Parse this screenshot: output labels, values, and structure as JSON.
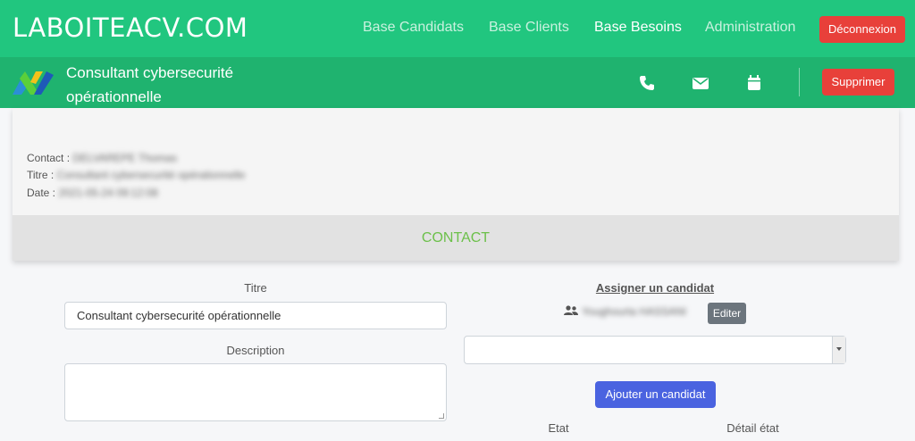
{
  "app": {
    "brand": "LABOITEACV.COM"
  },
  "nav": {
    "items": [
      {
        "label": "Base Candidats",
        "active": false
      },
      {
        "label": "Base Clients",
        "active": false
      },
      {
        "label": "Base Besoins",
        "active": true
      },
      {
        "label": "Administration",
        "active": false
      }
    ],
    "logout_label": "Déconnexion"
  },
  "subheader": {
    "title": "Consultant cybersecurité opérationnelle",
    "icons": [
      "phone-icon",
      "envelope-icon",
      "calendar-icon"
    ],
    "delete_label": "Supprimer"
  },
  "info_card": {
    "contact_label": "Contact :",
    "contact_value": "DELVAREPE Thomas",
    "titre_label": "Titre :",
    "titre_value": "Consultant cybersecurité opérationnelle",
    "date_label": "Date :",
    "date_value": "2021-05-24 09:12:08",
    "footer_label": "CONTACT"
  },
  "form": {
    "titre_label": "Titre",
    "titre_value": "Consultant cybersecurité opérationnelle",
    "description_label": "Description",
    "description_value": "",
    "assign_label": "Assigner un candidat",
    "candidate_name": "Youghourta HASSANI",
    "edit_label": "Editer",
    "add_candidate_label": "Ajouter un candidat",
    "etat_label": "Etat",
    "detail_etat_label": "Détail état"
  },
  "colors": {
    "topbar": "#21c67f",
    "subbar": "#1fb36f",
    "danger": "#e8403a",
    "primary": "#4a63e0",
    "contact_text": "#6cc04a"
  }
}
